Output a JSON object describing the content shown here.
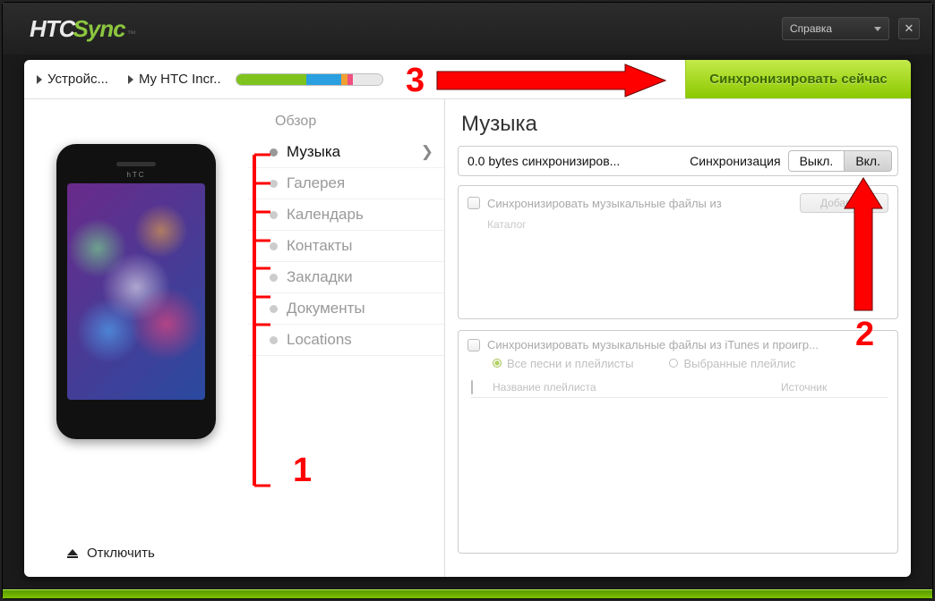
{
  "brand": {
    "part1": "HTC",
    "part2": "Sync",
    "tm": "™"
  },
  "titlebar": {
    "help": "Справка"
  },
  "breadcrumb": {
    "item1": "Устройс...",
    "item2": "My HTC Incr.."
  },
  "storage": {
    "segments": [
      {
        "color": "#7fc41e",
        "pct": 48
      },
      {
        "color": "#2aa0e0",
        "pct": 24
      },
      {
        "color": "#f0a030",
        "pct": 4
      },
      {
        "color": "#f05080",
        "pct": 4
      },
      {
        "color": "#e8e8e8",
        "pct": 20
      }
    ]
  },
  "sync_button": "Синхронизировать сейчас",
  "overview_label": "Обзор",
  "nav": [
    {
      "label": "Музыка",
      "active": true
    },
    {
      "label": "Галерея",
      "active": false
    },
    {
      "label": "Календарь",
      "active": false
    },
    {
      "label": "Контакты",
      "active": false
    },
    {
      "label": "Закладки",
      "active": false
    },
    {
      "label": "Документы",
      "active": false
    },
    {
      "label": "Locations",
      "active": false
    }
  ],
  "disconnect": "Отключить",
  "right": {
    "title": "Музыка",
    "status": "0.0  bytes синхронизиров...",
    "sync_label": "Синхронизация",
    "off": "Выкл.",
    "on": "Вкл.",
    "sec1_label": "Синхронизировать музыкальные файлы из",
    "add": "Добавить",
    "catalog": "Каталог",
    "sec2_label": "Синхронизировать музыкальные файлы из iTunes и проигр...",
    "opt_all": "Все песни и плейлисты",
    "opt_sel": "Выбранные плейлис",
    "col_name": "Название плейлиста",
    "col_src": "Источник"
  },
  "annotations": {
    "n1": "1",
    "n2": "2",
    "n3": "3"
  },
  "phone_brand": "hTC"
}
